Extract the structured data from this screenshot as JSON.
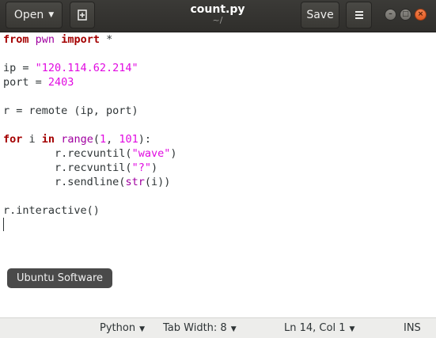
{
  "header": {
    "open_label": "Open",
    "title": "count.py",
    "subtitle": "~/",
    "save_label": "Save",
    "icons": {
      "open_caret": "chevron-down-icon",
      "pin": "new-document-icon",
      "menu": "hamburger-menu-icon",
      "minimize": "minimize-icon",
      "maximize": "maximize-icon",
      "close": "close-icon"
    }
  },
  "editor": {
    "lines": [
      "from pwn import *",
      "",
      "ip = \"120.114.62.214\"",
      "port = 2403",
      "",
      "r = remote (ip, port)",
      "",
      "for i in range(1, 101):",
      "        r.recvuntil(\"wave\")",
      "        r.recvuntil(\"?\")",
      "        r.sendline(str(i))",
      "",
      "r.interactive()",
      ""
    ],
    "tooltip": "Ubuntu Software"
  },
  "statusbar": {
    "language": "Python",
    "tab_width": "Tab Width: 8",
    "position": "Ln 14, Col 1",
    "mode": "INS"
  },
  "colors": {
    "header_bg": "#2f2e2b",
    "keyword": "#a40000",
    "string": "#e10ae1",
    "statusbar_bg": "#ededeb",
    "close_button": "#e05a22"
  }
}
